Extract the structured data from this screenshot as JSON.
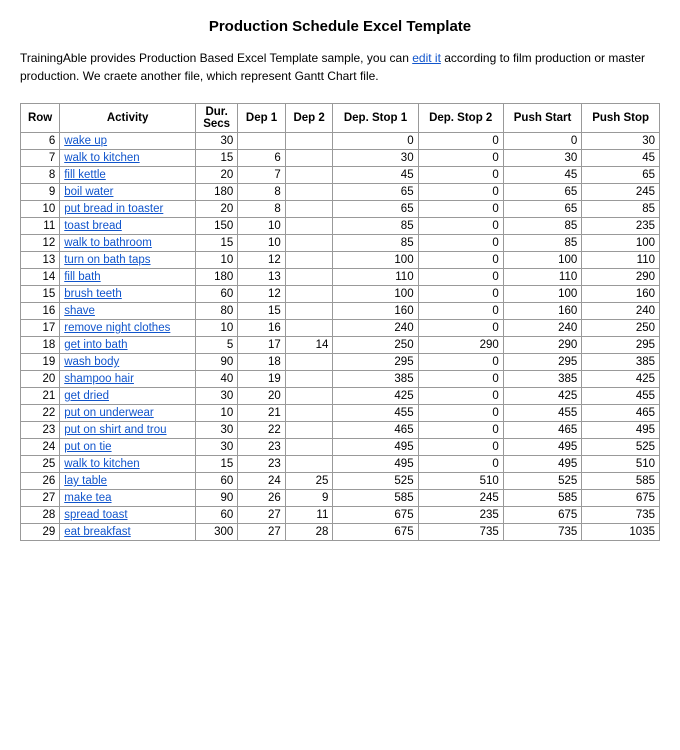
{
  "title": "Production Schedule Excel Template",
  "description": "TrainingAble provides Production Based Excel Template sample, you can edit it according to film production or master production. We craete another file, which represent Gantt Chart file.",
  "table": {
    "headers": [
      "Row",
      "Activity",
      "Dur. Secs",
      "Dep 1",
      "Dep 2",
      "Dep. Stop 1",
      "Dep. Stop 2",
      "Push Start",
      "Push Stop"
    ],
    "rows": [
      [
        6,
        "wake up",
        30,
        "",
        "",
        0,
        0,
        0,
        30
      ],
      [
        7,
        "walk to kitchen",
        15,
        6,
        "",
        30,
        0,
        30,
        45
      ],
      [
        8,
        "fill kettle",
        20,
        7,
        "",
        45,
        0,
        45,
        65
      ],
      [
        9,
        "boil water",
        180,
        8,
        "",
        65,
        0,
        65,
        245
      ],
      [
        10,
        "put bread in toaster",
        20,
        8,
        "",
        65,
        0,
        65,
        85
      ],
      [
        11,
        "toast bread",
        150,
        10,
        "",
        85,
        0,
        85,
        235
      ],
      [
        12,
        "walk to bathroom",
        15,
        10,
        "",
        85,
        0,
        85,
        100
      ],
      [
        13,
        "turn on bath taps",
        10,
        12,
        "",
        100,
        0,
        100,
        110
      ],
      [
        14,
        "fill bath",
        180,
        13,
        "",
        110,
        0,
        110,
        290
      ],
      [
        15,
        "brush teeth",
        60,
        12,
        "",
        100,
        0,
        100,
        160
      ],
      [
        16,
        "shave",
        80,
        15,
        "",
        160,
        0,
        160,
        240
      ],
      [
        17,
        "remove night clothes",
        10,
        16,
        "",
        240,
        0,
        240,
        250
      ],
      [
        18,
        "get into bath",
        5,
        17,
        14,
        250,
        290,
        290,
        295
      ],
      [
        19,
        "wash body",
        90,
        18,
        "",
        295,
        0,
        295,
        385
      ],
      [
        20,
        "shampoo hair",
        40,
        19,
        "",
        385,
        0,
        385,
        425
      ],
      [
        21,
        "get dried",
        30,
        20,
        "",
        425,
        0,
        425,
        455
      ],
      [
        22,
        "put on underwear",
        10,
        21,
        "",
        455,
        0,
        455,
        465
      ],
      [
        23,
        "put on shirt and trou",
        30,
        22,
        "",
        465,
        0,
        465,
        495
      ],
      [
        24,
        "put on tie",
        30,
        23,
        "",
        495,
        0,
        495,
        525
      ],
      [
        25,
        "walk to kitchen",
        15,
        23,
        "",
        495,
        0,
        495,
        510
      ],
      [
        26,
        "lay table",
        60,
        24,
        25,
        525,
        510,
        525,
        585
      ],
      [
        27,
        "make tea",
        90,
        26,
        9,
        585,
        245,
        585,
        675
      ],
      [
        28,
        "spread toast",
        60,
        27,
        11,
        675,
        235,
        675,
        735
      ],
      [
        29,
        "eat breakfast",
        300,
        27,
        28,
        675,
        735,
        735,
        1035
      ]
    ]
  }
}
